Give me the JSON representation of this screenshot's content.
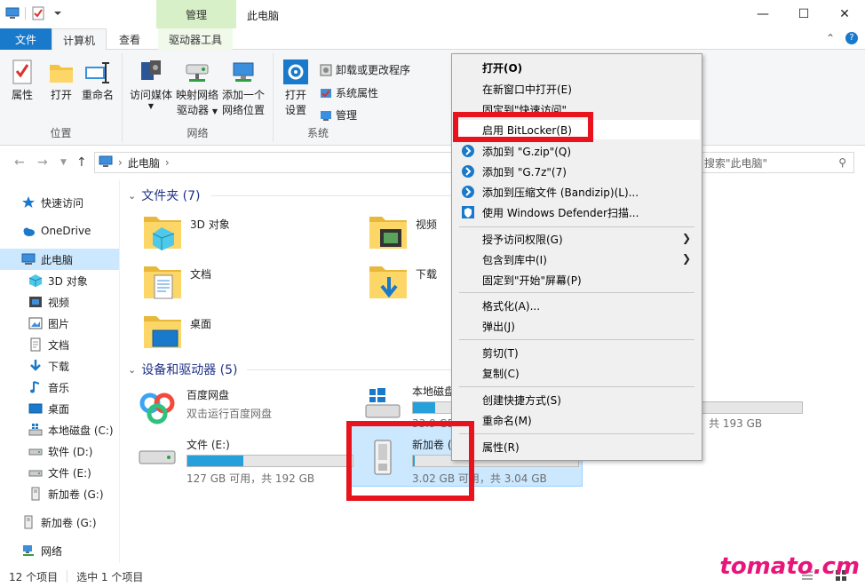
{
  "window": {
    "manage_tab": "管理",
    "title": "此电脑",
    "minimize": "—",
    "maximize": "☐",
    "close": "✕"
  },
  "tabs": {
    "file": "文件",
    "computer": "计算机",
    "view": "查看",
    "drive_tools": "驱动器工具"
  },
  "ribbon": {
    "location": {
      "label": "位置",
      "properties": "属性",
      "open": "打开",
      "rename": "重命名"
    },
    "network": {
      "label": "网络",
      "access_media": "访问媒体",
      "map_drive_1": "映射网络",
      "map_drive_2": "驱动器",
      "add_location_1": "添加一个",
      "add_location_2": "网络位置"
    },
    "system": {
      "label": "系统",
      "open_settings_1": "打开",
      "open_settings_2": "设置",
      "uninstall": "卸载或更改程序",
      "sys_properties": "系统属性",
      "manage": "管理"
    }
  },
  "address": {
    "path": "此电脑",
    "search_placeholder": "搜索\"此电脑\""
  },
  "nav": {
    "quick_access": "快速访问",
    "onedrive": "OneDrive",
    "this_pc": "此电脑",
    "objects_3d": "3D 对象",
    "videos": "视频",
    "pictures": "图片",
    "documents": "文档",
    "downloads": "下载",
    "music": "音乐",
    "desktop": "桌面",
    "local_c": "本地磁盘 (C:)",
    "soft_d": "软件 (D:)",
    "file_e": "文件 (E:)",
    "new_vol_g": "新加卷 (G:)",
    "new_vol_g2": "新加卷 (G:)",
    "network": "网络"
  },
  "content": {
    "folders_header": "文件夹 (7)",
    "folders": {
      "objects_3d": "3D 对象",
      "videos": "视频",
      "documents": "文档",
      "downloads": "下载",
      "desktop": "桌面"
    },
    "devices_header": "设备和驱动器 (5)",
    "drives": {
      "baidu_name": "百度网盘",
      "baidu_sub": "双击运行百度网盘",
      "local_name": "本地磁盘",
      "local_size": "33.9 GB",
      "local_fill": 0.43,
      "right_total": "共 193 GB",
      "file_e_name": "文件 (E:)",
      "file_e_size": "127 GB 可用，共 192 GB",
      "file_e_fill": 0.34,
      "new_vol_name": "新加卷 (",
      "new_vol_size": "3.02 GB 可用，共 3.04 GB",
      "new_vol_fill": 0.01
    }
  },
  "context_menu": {
    "open": "打开(O)",
    "open_new_window": "在新窗口中打开(E)",
    "pin_quick": "固定到\"快速访问\"",
    "bitlocker": "启用 BitLocker(B)",
    "add_zip": "添加到 \"G.zip\"(Q)",
    "add_7z": "添加到 \"G.7z\"(7)",
    "add_bandizip": "添加到压缩文件 (Bandizip)(L)...",
    "defender": "使用 Windows Defender扫描...",
    "grant_access": "授予访问权限(G)",
    "include_library": "包含到库中(I)",
    "pin_start": "固定到\"开始\"屏幕(P)",
    "format": "格式化(A)...",
    "eject": "弹出(J)",
    "cut": "剪切(T)",
    "copy": "复制(C)",
    "create_shortcut": "创建快捷方式(S)",
    "rename": "重命名(M)",
    "properties": "属性(R)"
  },
  "status": {
    "items": "12 个项目",
    "selected": "选中 1 个项目"
  },
  "watermark": "tomato.cm",
  "colors": {
    "accent": "#1979ca",
    "annotation": "#e8131c",
    "bar_fill": "#26a0da",
    "selection": "#cce8ff"
  }
}
